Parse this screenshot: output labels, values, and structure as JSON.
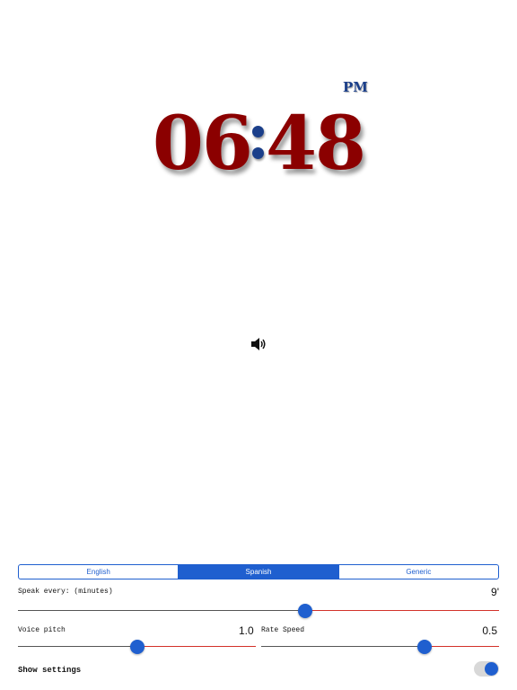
{
  "clock": {
    "ampm": "PM",
    "hours": "06",
    "minutes": "48",
    "digit_color": "#8b0000",
    "accent_color": "#1b3f8a"
  },
  "speaker": {
    "icon": "speaker-icon"
  },
  "language_selector": {
    "options": [
      "English",
      "Spanish",
      "Generic"
    ],
    "selected": "Spanish"
  },
  "speak_every": {
    "label": "Speak every: (minutes)",
    "value": "9'",
    "slider_fraction": 0.6
  },
  "voice_pitch": {
    "label": "Voice pitch",
    "value": "1.0",
    "slider_fraction": 0.5
  },
  "rate_speed": {
    "label": "Rate Speed",
    "value": "0.5",
    "slider_fraction": 0.7
  },
  "show_settings": {
    "label": "Show settings",
    "on": true
  },
  "colors": {
    "accent": "#1f5fcf",
    "track_max": "#d3322a",
    "track_min": "#555555"
  }
}
